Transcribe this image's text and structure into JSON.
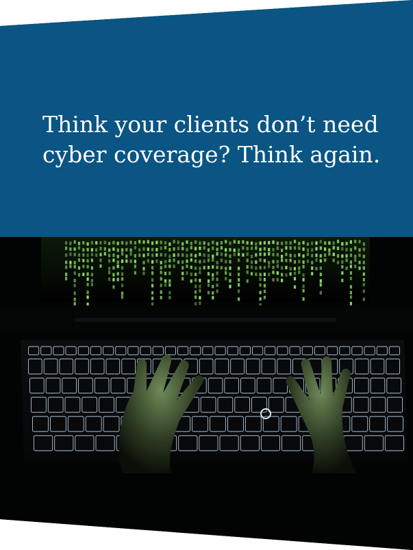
{
  "headline": {
    "line1": "Think your clients don’t  need",
    "line2": "cyber coverage? Think again."
  },
  "photo": {
    "subject": "hands-on-backlit-keyboard",
    "screen_glyph_color": "#8fe06a",
    "key_glow_color": "#cfe9ff"
  },
  "colors": {
    "header_bg": "#0a5583",
    "photo_bg": "#020303",
    "headline_text": "#ffffff"
  }
}
